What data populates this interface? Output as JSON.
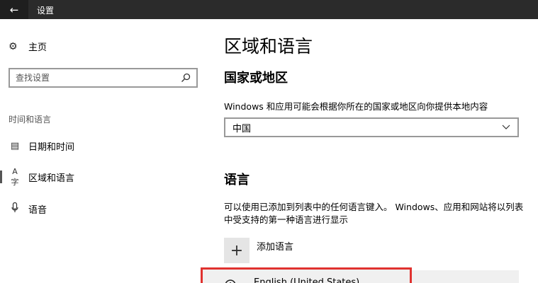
{
  "window": {
    "title": "设置",
    "back_icon": "arrow-left-icon"
  },
  "sidebar": {
    "home_label": "主页",
    "search_placeholder": "查找设置",
    "section_label": "时间和语言",
    "items": [
      {
        "label": "日期和时间",
        "icon": "calendar-clock-icon",
        "selected": false
      },
      {
        "label": "区域和语言",
        "icon": "region-language-icon",
        "selected": true
      },
      {
        "label": "语音",
        "icon": "microphone-icon",
        "selected": false
      }
    ]
  },
  "main": {
    "page_title": "区域和语言",
    "country_heading": "国家或地区",
    "country_desc": "Windows 和应用可能会根据你所在的国家或地区向你提供本地内容",
    "country_value": "中国",
    "language_heading": "语言",
    "language_desc": "可以使用已添加到列表中的任何语言键入。 Windows、应用和网站将以列表中受支持的第一种语言进行显示",
    "add_language_label": "添加语言",
    "languages": [
      {
        "label": "English (United States)"
      }
    ]
  },
  "colors": {
    "titlebar": "#2b2b2b",
    "highlight_border": "#e0322f"
  }
}
